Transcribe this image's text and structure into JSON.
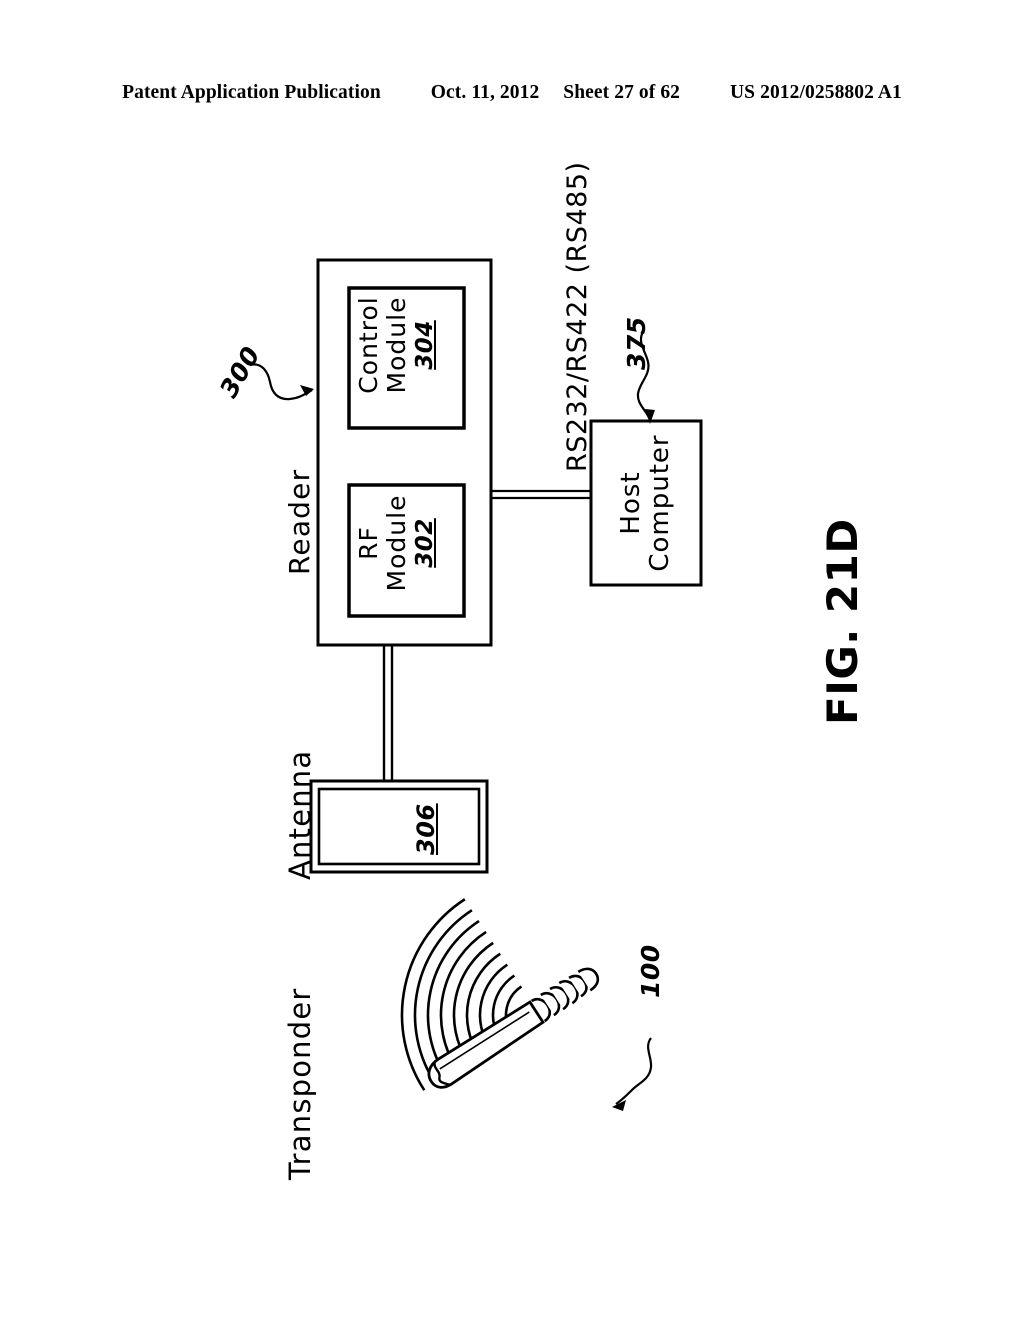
{
  "header": {
    "publication": "Patent Application Publication",
    "date": "Oct. 11, 2012",
    "sheet": "Sheet 27 of 62",
    "docnumber": "US 2012/0258802 A1"
  },
  "figure": {
    "caption": "FIG. 21D",
    "row_labels": {
      "transponder": "Transponder",
      "antenna": "Antenna",
      "reader": "Reader"
    },
    "reader": {
      "control_module": {
        "line1": "Control",
        "line2": "Module",
        "numeral": "304"
      },
      "rf_module": {
        "line1": "RF",
        "line2": "Module",
        "numeral": "302"
      },
      "numeral": "300"
    },
    "antenna": {
      "numeral": "306"
    },
    "host_computer": {
      "line1": "Host",
      "line2": "Computer",
      "numeral": "375"
    },
    "bus_label": "RS232/RS422 (RS485)",
    "transponder": {
      "numeral": "100"
    }
  },
  "colors": {
    "ink": "#000000",
    "paper": "#ffffff"
  }
}
